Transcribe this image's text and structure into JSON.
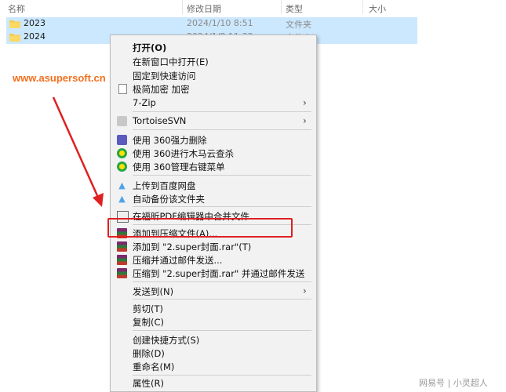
{
  "columns": {
    "name": "名称",
    "date": "修改日期",
    "type": "类型",
    "size": "大小"
  },
  "rows": [
    {
      "name": "2023",
      "date": "2024/1/10 8:51",
      "type": "文件夹"
    },
    {
      "name": "2024",
      "date": "2024/1/8 11:32",
      "type": "文件夹"
    }
  ],
  "watermark": "www.asupersoft.cn",
  "menu": {
    "open": "打开(O)",
    "open_new_window": "在新窗口中打开(E)",
    "pin_quick_access": "固定到快速访问",
    "encrypt": "极简加密 加密",
    "zip7": "7-Zip",
    "tortoise": "TortoiseSVN",
    "del360": "使用 360强力删除",
    "trojan360": "使用 360进行木马云查杀",
    "manage360": "使用 360管理右键菜单",
    "upload_baidu": "上传到百度网盘",
    "auto_backup": "自动备份该文件夹",
    "pdf_merge": "在福昕PDF编辑器中合并文件",
    "add_archive": "添加到压缩文件(A)...",
    "add_rar": "添加到 \"2.super封面.rar\"(T)",
    "compress_email": "压缩并通过邮件发送...",
    "compress_rar_email": "压缩到 \"2.super封面.rar\" 并通过邮件发送",
    "send_to": "发送到(N)",
    "cut": "剪切(T)",
    "copy": "复制(C)",
    "create_shortcut": "创建快捷方式(S)",
    "delete": "删除(D)",
    "rename": "重命名(M)",
    "properties": "属性(R)"
  },
  "footer": {
    "source": "网易号",
    "author": "小灵超人"
  },
  "colors": {
    "selection": "#cce8ff",
    "highlight_box": "#e02020",
    "arrow": "#e02020",
    "watermark": "#f2701f"
  }
}
